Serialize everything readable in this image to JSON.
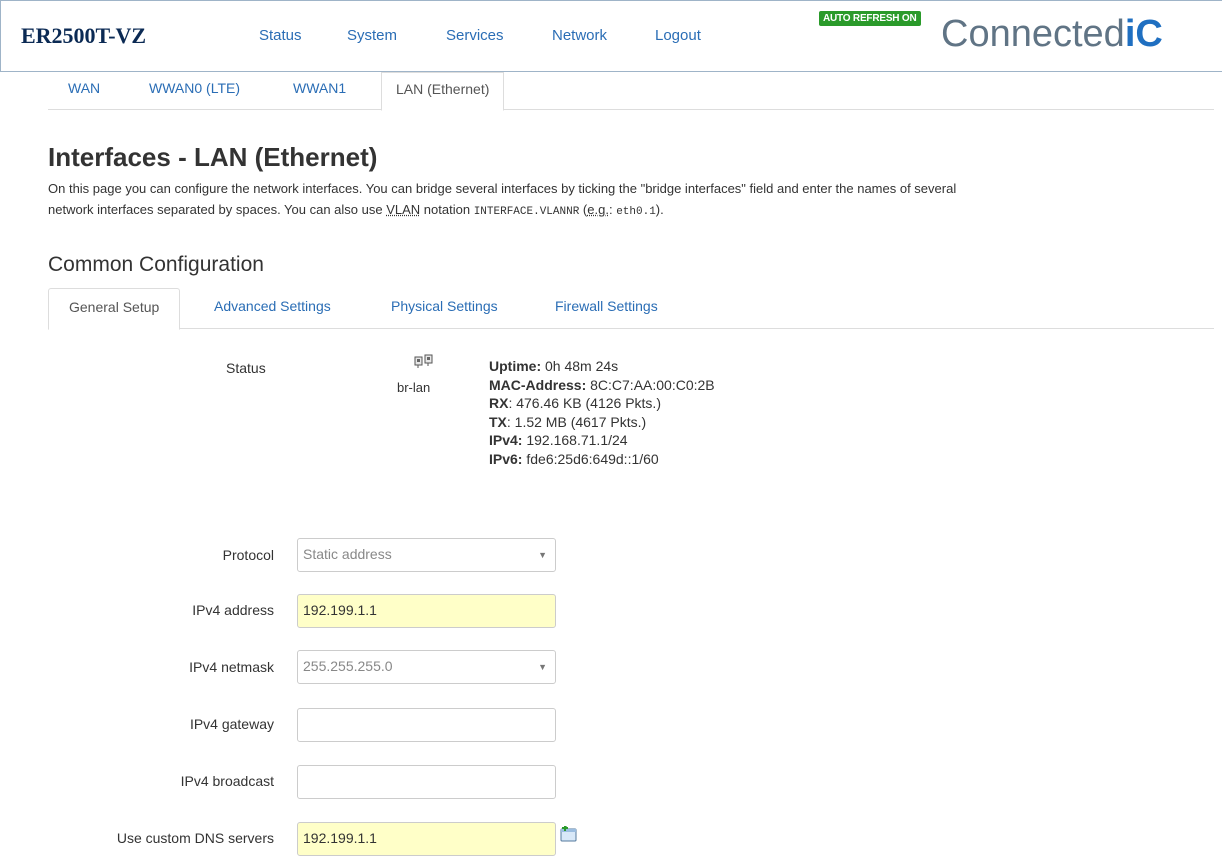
{
  "brand": "ER2500T-VZ",
  "nav": [
    "Status",
    "System",
    "Services",
    "Network",
    "Logout"
  ],
  "badge": "AUTO REFRESH ON",
  "logo": {
    "text": "Connected",
    "mark": "iC"
  },
  "subtabs": [
    "WAN",
    "WWAN0 (LTE)",
    "WWAN1",
    "LAN (Ethernet)"
  ],
  "page": {
    "title": "Interfaces - LAN (Ethernet)",
    "desc_1": "On this page you can configure the network interfaces. You can bridge several interfaces by ticking the \"bridge interfaces\" field and enter the names of several",
    "desc_2a": "network interfaces separated by spaces. You can also use ",
    "desc_vlan": "VLAN",
    "desc_2b": " notation ",
    "desc_code1": "INTERFACE.VLANNR",
    "desc_2c": " (",
    "desc_eg": "e.g.",
    "desc_2d": ": ",
    "desc_code2": "eth0.1",
    "desc_2e": ")."
  },
  "section": "Common Configuration",
  "cfgtabs": [
    "General Setup",
    "Advanced Settings",
    "Physical Settings",
    "Firewall Settings"
  ],
  "status": {
    "label": "Status",
    "iface": "br-lan",
    "uptime_k": "Uptime:",
    "uptime_v": " 0h 48m 24s",
    "mac_k": "MAC-Address:",
    "mac_v": " 8C:C7:AA:00:C0:2B",
    "rx_k": "RX",
    "rx_v": ": 476.46 KB (4126 Pkts.)",
    "tx_k": "TX",
    "tx_v": ": 1.52 MB (4617 Pkts.)",
    "ipv4_k": "IPv4:",
    "ipv4_v": " 192.168.71.1/24",
    "ipv6_k": "IPv6:",
    "ipv6_v": " fde6:25d6:649d::1/60"
  },
  "form": {
    "protocol_label": "Protocol",
    "protocol_value": "Static address",
    "ipv4addr_label": "IPv4 address",
    "ipv4addr_value": "192.199.1.1",
    "netmask_label": "IPv4 netmask",
    "netmask_value": "255.255.255.0",
    "gateway_label": "IPv4 gateway",
    "gateway_value": "",
    "broadcast_label": "IPv4 broadcast",
    "broadcast_value": "",
    "dns_label": "Use custom DNS servers",
    "dns_value": "192.199.1.1"
  },
  "colors": {
    "link": "#2a6db5",
    "badge": "#2a9a2a",
    "brand": "#0b2a54",
    "highlight": "#ffffc8"
  }
}
